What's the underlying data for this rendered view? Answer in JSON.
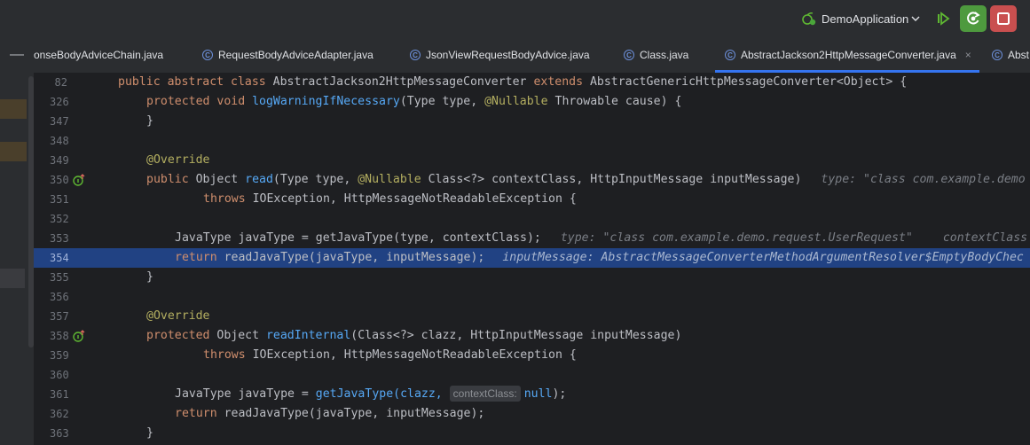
{
  "run_config": {
    "name": "DemoApplication"
  },
  "toolbar": {
    "debug_run_icon": "debug-icon",
    "rerun_icon": "rerun-icon",
    "stop_icon": "stop-icon"
  },
  "tabs": [
    {
      "label": "onseBodyAdviceChain.java",
      "icon": ""
    },
    {
      "label": "RequestBodyAdviceAdapter.java",
      "icon": "C"
    },
    {
      "label": "JsonViewRequestBodyAdvice.java",
      "icon": "C"
    },
    {
      "label": "Class.java",
      "icon": "C"
    },
    {
      "label": "AbstractJackson2HttpMessageConverter.java",
      "icon": "C"
    },
    {
      "label": "Abst",
      "icon": "C"
    }
  ],
  "active_tab_close": "×",
  "collapse_label": "—",
  "lines": [
    {
      "num": "82"
    },
    {
      "num": "326"
    },
    {
      "num": "347"
    },
    {
      "num": "348"
    },
    {
      "num": "349"
    },
    {
      "num": "350"
    },
    {
      "num": "351"
    },
    {
      "num": "352"
    },
    {
      "num": "353"
    },
    {
      "num": "354"
    },
    {
      "num": "355"
    },
    {
      "num": "356"
    },
    {
      "num": "357"
    },
    {
      "num": "358"
    },
    {
      "num": "359"
    },
    {
      "num": "360"
    },
    {
      "num": "361"
    },
    {
      "num": "362"
    },
    {
      "num": "363"
    }
  ],
  "code": {
    "l82": {
      "k1": "public abstract class ",
      "t1": "AbstractJackson2HttpMessageConverter ",
      "k2": "extends ",
      "t2": "AbstractGenericHttpMessageConverter<Object> {"
    },
    "l326": {
      "k1": "protected void ",
      "f1": "logWarningIfNecessary",
      "t1": "(Type type, ",
      "a1": "@Nullable ",
      "t2": "Throwable cause) {"
    },
    "l347": {
      "t1": "}"
    },
    "l349": {
      "a1": "@Override"
    },
    "l350": {
      "k1": "public ",
      "t1": "Object ",
      "f1": "read",
      "t2": "(Type type, ",
      "a1": "@Nullable ",
      "t3": "Class<?> contextClass, HttpInputMessage inputMessage)",
      "h1": "type: \"class com.example.demo"
    },
    "l351": {
      "k1": "throws ",
      "t1": "IOException, HttpMessageNotReadableException {"
    },
    "l353": {
      "t1": "JavaType javaType = getJavaType(type, contextClass);",
      "h1": "type: \"class com.example.demo.request.UserRequest\"",
      "h2": "contextClass"
    },
    "l354": {
      "k1": "return ",
      "t1": "readJavaType(javaType, inputMessage);",
      "h1": "inputMessage: AbstractMessageConverterMethodArgumentResolver$EmptyBodyChec"
    },
    "l355": {
      "t1": "}"
    },
    "l357": {
      "a1": "@Override"
    },
    "l358": {
      "k1": "protected ",
      "t1": "Object ",
      "f1": "readInternal",
      "t2": "(Class<?> clazz, HttpInputMessage inputMessage)"
    },
    "l359": {
      "k1": "throws ",
      "t1": "IOException, HttpMessageNotReadableException {"
    },
    "l361": {
      "t1": "JavaType javaType = ",
      "f1": "getJavaType",
      "f2": "(clazz, ",
      "inlay": "contextClass:",
      "f3": "null",
      "t2": ");"
    },
    "l362": {
      "k1": "return ",
      "t1": "readJavaType(javaType, inputMessage);"
    },
    "l363": {
      "t1": "}"
    }
  }
}
